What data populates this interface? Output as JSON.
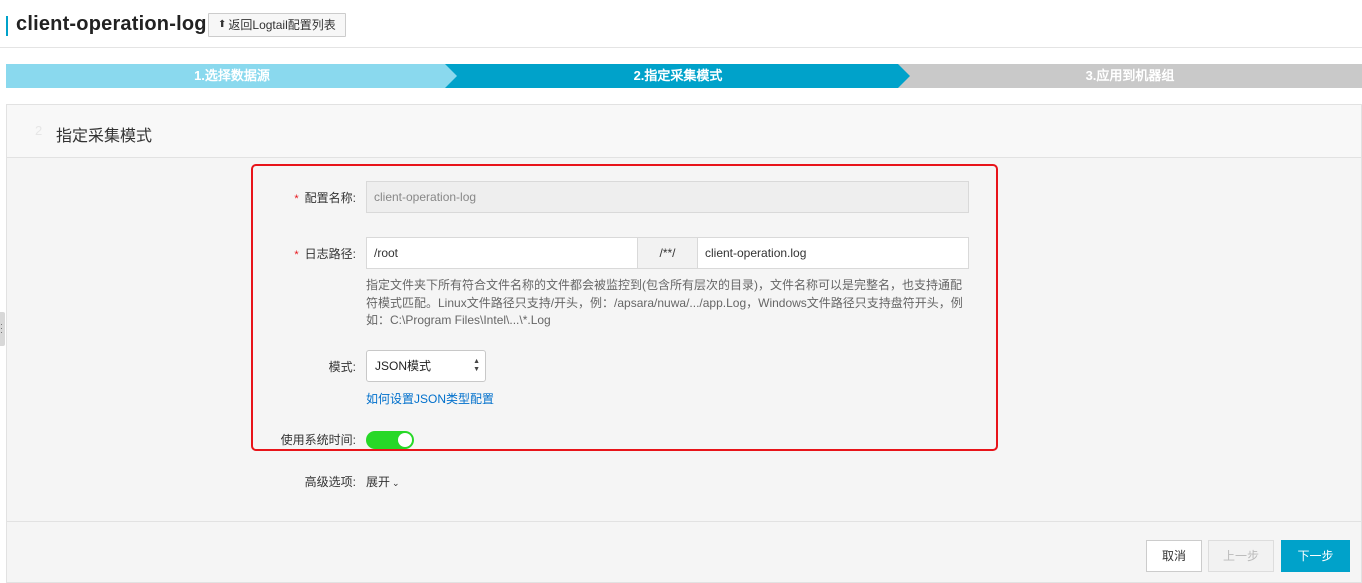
{
  "header": {
    "title": "client-operation-log",
    "back_label": "返回Logtail配置列表"
  },
  "steps": [
    {
      "label": "1.选择数据源",
      "state": "done"
    },
    {
      "label": "2.指定采集模式",
      "state": "active"
    },
    {
      "label": "3.应用到机器组",
      "state": "pending"
    }
  ],
  "panel": {
    "step_number": "2",
    "title": "指定采集模式"
  },
  "form": {
    "config_name": {
      "label": "配置名称:",
      "value": "client-operation-log"
    },
    "log_path": {
      "label": "日志路径:",
      "dir_value": "/root",
      "separator": "/**/",
      "file_value": "client-operation.log"
    },
    "help_text": "指定文件夹下所有符合文件名称的文件都会被监控到(包含所有层次的目录)，文件名称可以是完整名，也支持通配符模式匹配。Linux文件路径只支持/开头，例：/apsara/nuwa/.../app.Log，Windows文件路径只支持盘符开头，例如：C:\\Program Files\\Intel\\...\\*.Log",
    "mode": {
      "label": "模式:",
      "value": "JSON模式",
      "link": "如何设置JSON类型配置"
    },
    "system_time": {
      "label": "使用系统时间:",
      "enabled": true
    },
    "advanced": {
      "label": "高级选项:",
      "toggle": "展开"
    }
  },
  "footer": {
    "cancel": "取消",
    "prev": "上一步",
    "next": "下一步"
  },
  "colors": {
    "accent": "#00a2ca",
    "step_done": "#8ad9ee",
    "step_pending": "#c9c9c9",
    "highlight_border": "#e8141a",
    "toggle_on": "#27d827",
    "link": "#0070cc"
  }
}
